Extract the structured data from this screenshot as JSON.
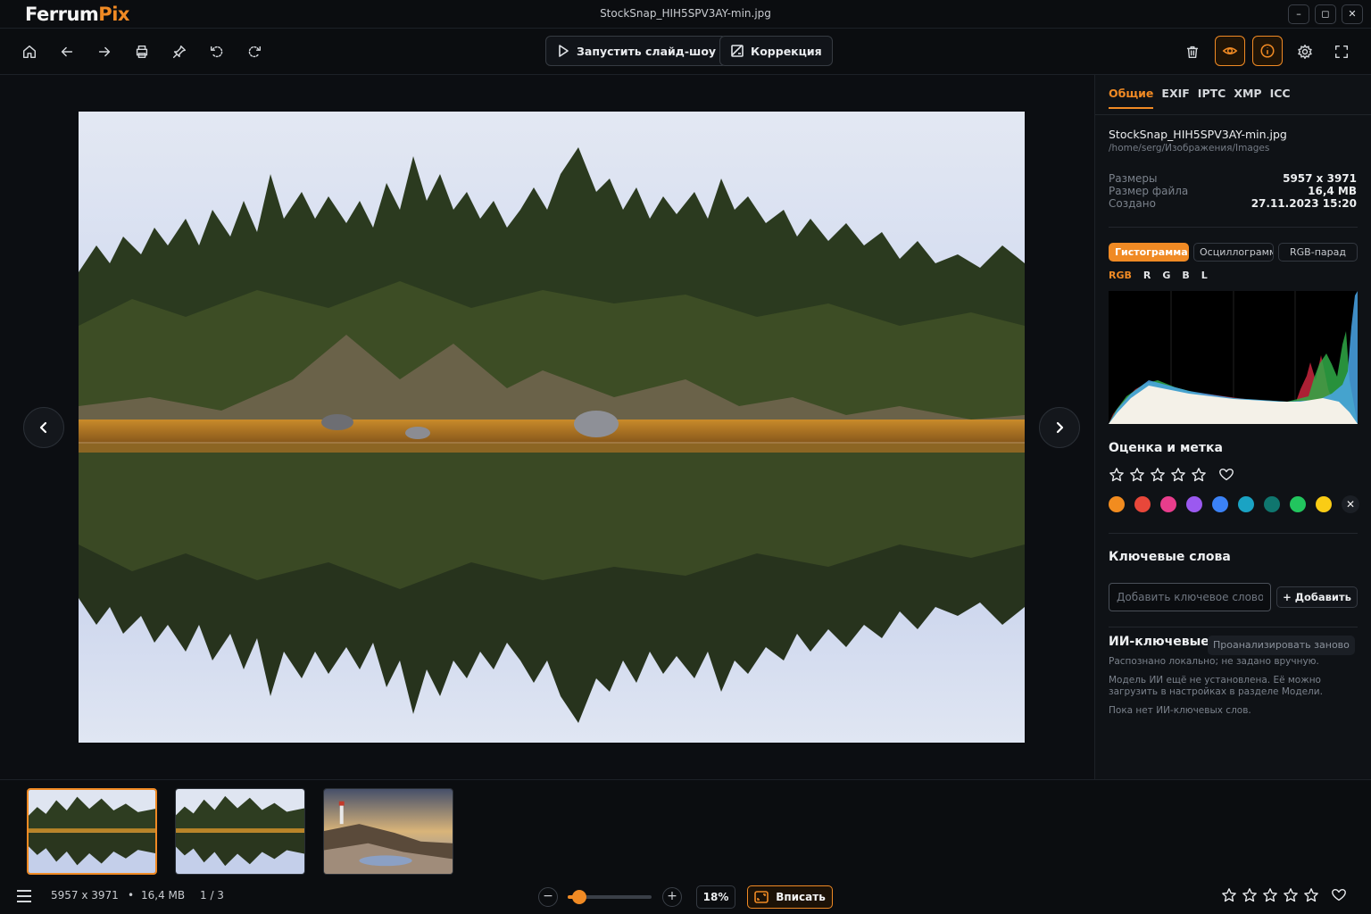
{
  "app": {
    "logo_main": "Ferrum",
    "logo_accent": "Pix",
    "window_title": "StockSnap_HIH5SPV3AY-min.jpg",
    "window_controls": [
      "–",
      "◻",
      "✕"
    ]
  },
  "toolbar": {
    "slideshow_label": "Запустить слайд-шоу",
    "correction_label": "Коррекция",
    "left_icons": [
      "home-icon",
      "arrow-left-icon",
      "arrow-right-icon",
      "print-icon",
      "pin-icon",
      "rotate-left-icon",
      "rotate-right-icon"
    ],
    "right_icons": [
      "trash-icon",
      "eye-icon",
      "info-icon",
      "gear-icon",
      "fullscreen-icon"
    ]
  },
  "panel": {
    "tabs": [
      "Общие",
      "EXIF",
      "IPTC",
      "XMP",
      "ICC"
    ],
    "active_tab": "Общие",
    "file_name": "StockSnap_HIH5SPV3AY-min.jpg",
    "file_path": "/home/serg/Изображения/Images",
    "meta": [
      {
        "key": "Размеры",
        "value": "5957 x 3971"
      },
      {
        "key": "Размер файла",
        "value": "16,4 MB"
      },
      {
        "key": "Создано",
        "value": "27.11.2023 15:20"
      }
    ],
    "hist_tabs": [
      "Гистограмма",
      "Осциллограмма",
      "RGB-парад"
    ],
    "channels": [
      "RGB",
      "R",
      "G",
      "B",
      "L"
    ],
    "rating_title": "Оценка и метка",
    "rating": 0,
    "label_colors": [
      "#f28c1f",
      "#e8473a",
      "#e83d8c",
      "#9b59f0",
      "#3b82f6",
      "#1aa3c4",
      "#0f766e",
      "#22c55e",
      "#facc15"
    ],
    "keywords_title": "Ключевые слова",
    "keyword_placeholder": "Добавить ключевое слово",
    "keyword_add": "+ Добавить",
    "ai_title": "ИИ-ключевые слова",
    "ai_reanalyze": "Проанализировать заново",
    "ai_line1": "Распознано локально; не задано вручную.",
    "ai_line2": "Модель ИИ ещё не установлена. Её можно загрузить в настройках в разделе Модели.",
    "ai_line3": "Пока нет ИИ-ключевых слов."
  },
  "status": {
    "dimensions": "5957 x 3971",
    "bullet": "•",
    "size": "16,4 MB",
    "position": "1 / 3",
    "zoom_minus": "−",
    "zoom_plus": "+",
    "zoom_level": 18,
    "zoom_text": "18%",
    "fit_label": "Вписать",
    "bottom_rating": 0
  },
  "colors": {
    "accent": "#f08a24",
    "background": "#0b0d10"
  }
}
